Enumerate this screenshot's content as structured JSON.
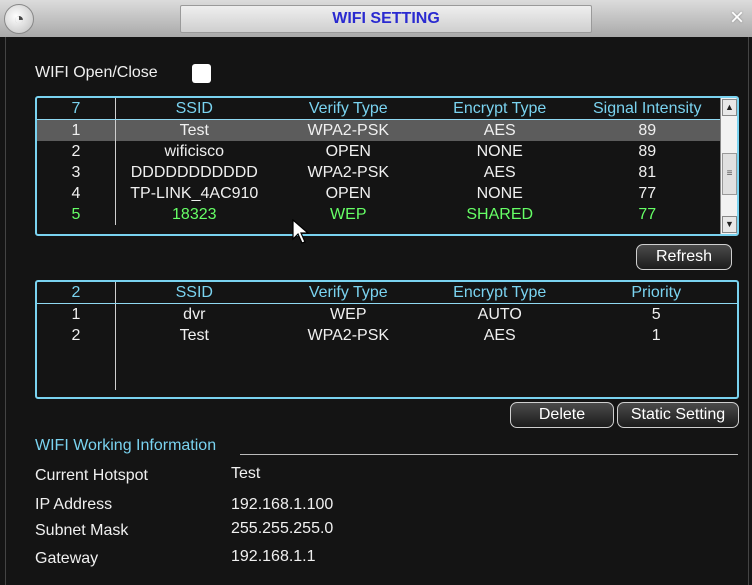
{
  "window": {
    "title": "WIFI SETTING",
    "close_glyph": "×",
    "logo_icon": "logo-icon"
  },
  "toggle": {
    "label": "WIFI Open/Close",
    "checked": false
  },
  "scan_table": {
    "headers": [
      "7",
      "SSID",
      "Verify Type",
      "Encrypt Type",
      "Signal Intensity"
    ],
    "rows": [
      [
        "1",
        "Test",
        "WPA2-PSK",
        "AES",
        "89"
      ],
      [
        "2",
        "wificisco",
        "OPEN",
        "NONE",
        "89"
      ],
      [
        "3",
        "DDDDDDDDDDD",
        "WPA2-PSK",
        "AES",
        "81"
      ],
      [
        "4",
        "TP-LINK_4AC910",
        "OPEN",
        "NONE",
        "77"
      ],
      [
        "5",
        "18323",
        "WEP",
        "SHARED",
        "77"
      ]
    ],
    "selected_row": 0,
    "highlight_row": 4,
    "highlight_color": "#66ff66"
  },
  "buttons": {
    "refresh": "Refresh",
    "delete": "Delete",
    "static_setting": "Static Setting"
  },
  "saved_table": {
    "headers": [
      "2",
      "SSID",
      "Verify Type",
      "Encrypt Type",
      "Priority"
    ],
    "rows": [
      [
        "1",
        "dvr",
        "WEP",
        "AUTO",
        "5"
      ],
      [
        "2",
        "Test",
        "WPA2-PSK",
        "AES",
        "1"
      ]
    ]
  },
  "info": {
    "title": "WIFI Working Information",
    "current_hotspot_label": "Current Hotspot",
    "current_hotspot": "Test",
    "ip_label": "IP Address",
    "ip": "192.168.1.100",
    "subnet_label": "Subnet Mask",
    "subnet": "255.255.255.0",
    "gateway_label": "Gateway",
    "gateway": "192.168.1.1"
  },
  "colors": {
    "accent": "#7ad3f0",
    "title_text": "#2a2ad0",
    "background": "#141414"
  }
}
